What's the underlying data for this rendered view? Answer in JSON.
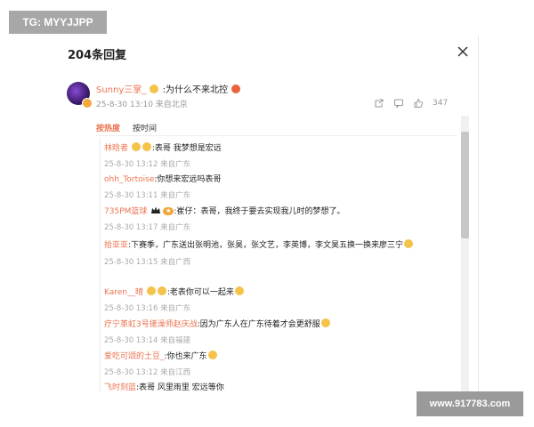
{
  "watermarks": {
    "top_left": "TG: MYYJJPP",
    "bottom_right": "www.917783.com"
  },
  "header": {
    "title": "204条回复"
  },
  "main_comment": {
    "username": "Sunny三掌_",
    "text": ":为什么不来北控",
    "date": "25-8-30 13:10 来自北京",
    "likes": "347"
  },
  "tabs": [
    {
      "label": "按热度"
    },
    {
      "label": "按时间"
    }
  ],
  "replies": [
    {
      "username": "林晗者",
      "text": ":表哥 我梦想是宏远",
      "meta": "25-8-30 13:12 来自广东"
    },
    {
      "username": "ohh_Tortoise",
      "text": ":你想来宏远吗表哥",
      "meta": "25-8-30 13:11 来自广东"
    },
    {
      "username": "735PM篮球",
      "text": ":崔仔：表哥，我终于要去实现我儿时的梦想了。",
      "meta": "25-8-30 13:17 来自广东"
    },
    {
      "username": "拾亚亚",
      "text": ":下赛季，广东送出张明池，张昊，张文艺，李英博，李文昊五换一换来廖三宁",
      "meta": "25-8-30 13:15 来自广西"
    },
    {
      "username": "Karen__晴",
      "text": ":老表你可以一起来",
      "meta": "25-8-30 13:16 来自广东"
    },
    {
      "username": "疗宁革虹3号搓澡师赵庆战",
      "text": ":因为广东人在广东待着才会更舒服",
      "meta": "25-8-30 13:14 来自福建"
    },
    {
      "username": "爱吃可颂的土豆_",
      "text": ":你也来广东",
      "meta": "25-8-30 13:12 来自江西"
    },
    {
      "username": "飞时刻篮",
      "text": ":表哥 风里雨里 宏远等你",
      "meta": ""
    }
  ]
}
